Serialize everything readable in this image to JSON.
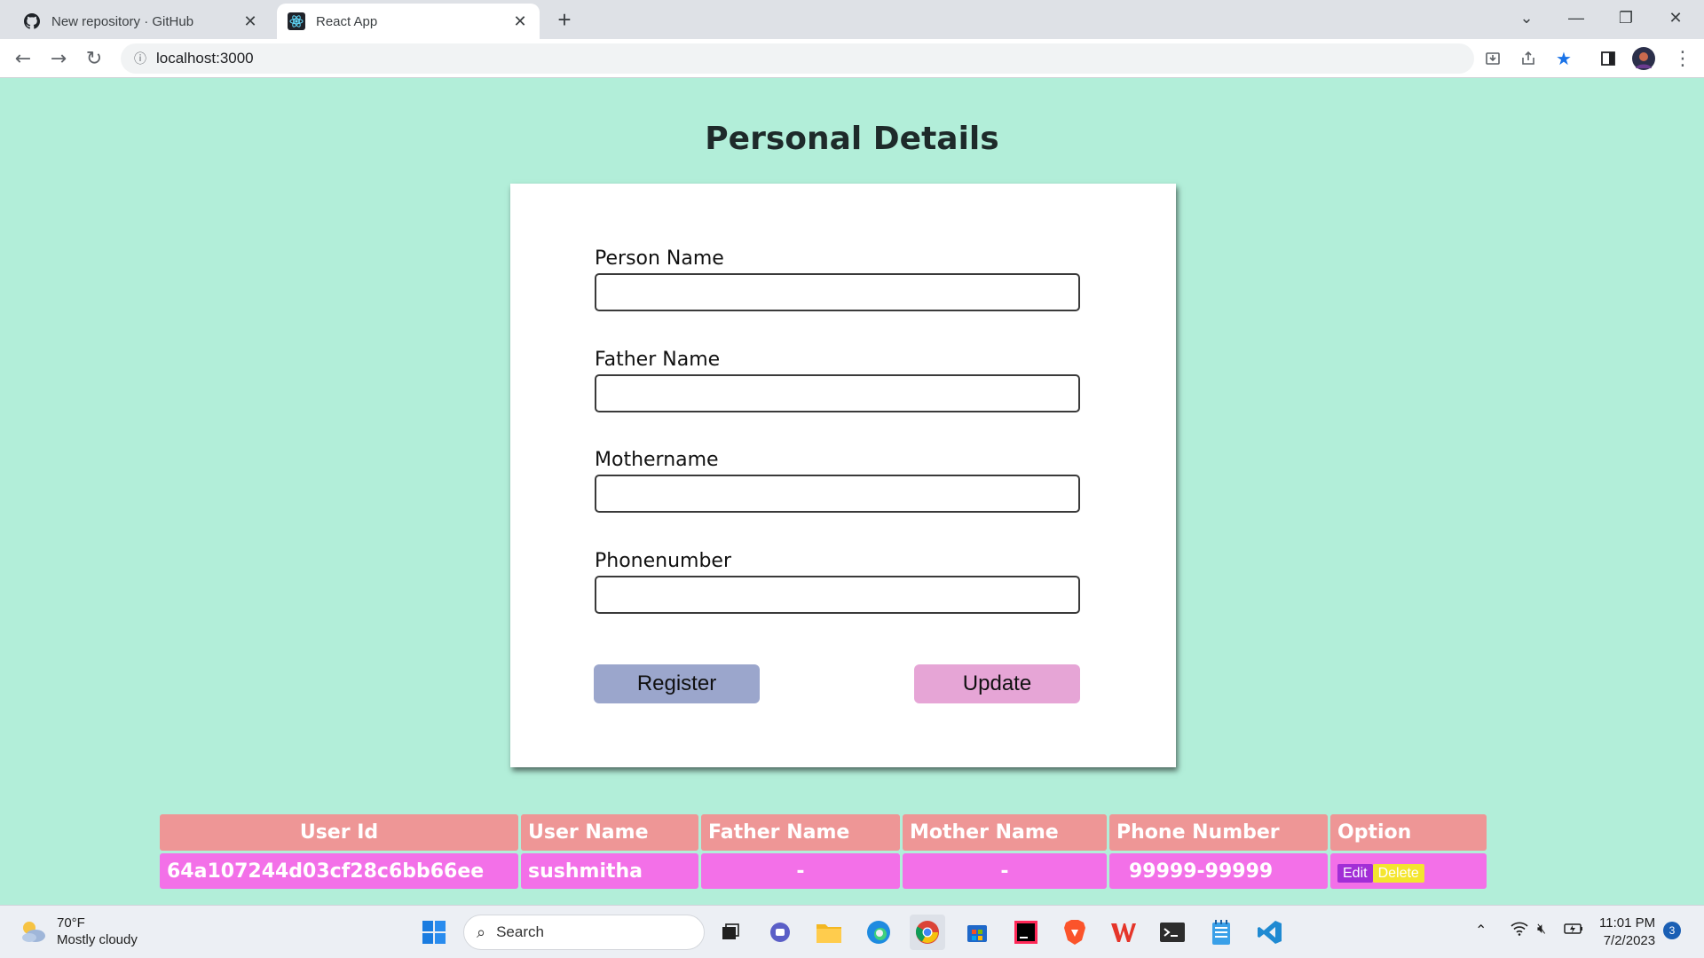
{
  "browser": {
    "tabs": [
      {
        "title": "New repository · GitHub",
        "favicon": "github-icon"
      },
      {
        "title": "React App",
        "favicon": "react-icon",
        "active": true
      }
    ],
    "address": "localhost:3000"
  },
  "page": {
    "title": "Personal Details",
    "form": {
      "person_name_label": "Person Name",
      "person_name_value": "",
      "father_name_label": "Father Name",
      "father_name_value": "",
      "mother_name_label": "Mothername",
      "mother_name_value": "",
      "phone_label": "Phonenumber",
      "phone_value": "",
      "register_label": "Register",
      "update_label": "Update"
    },
    "table": {
      "headers": [
        "User Id",
        "User Name",
        "Father Name",
        "Mother Name",
        "Phone Number",
        "Option"
      ],
      "rows": [
        {
          "user_id": "64a107244d03cf28c6bb66ee",
          "user_name": "sushmitha",
          "father_name": "-",
          "mother_name": "-",
          "phone": "99999-99999",
          "edit_label": "Edit",
          "delete_label": "Delete"
        }
      ]
    }
  },
  "taskbar": {
    "weather_temp": "70°F",
    "weather_desc": "Mostly cloudy",
    "search_label": "Search",
    "time": "11:01 PM",
    "date": "7/2/2023",
    "notification_count": "3"
  },
  "colors": {
    "page_bg": "#b2eed9",
    "header_cell": "#ee9696",
    "data_cell": "#f370e8",
    "register_btn": "#9ba6cc",
    "update_btn": "#e6a5d6",
    "edit_btn": "#a22ed6",
    "delete_btn": "#f4e52f"
  }
}
